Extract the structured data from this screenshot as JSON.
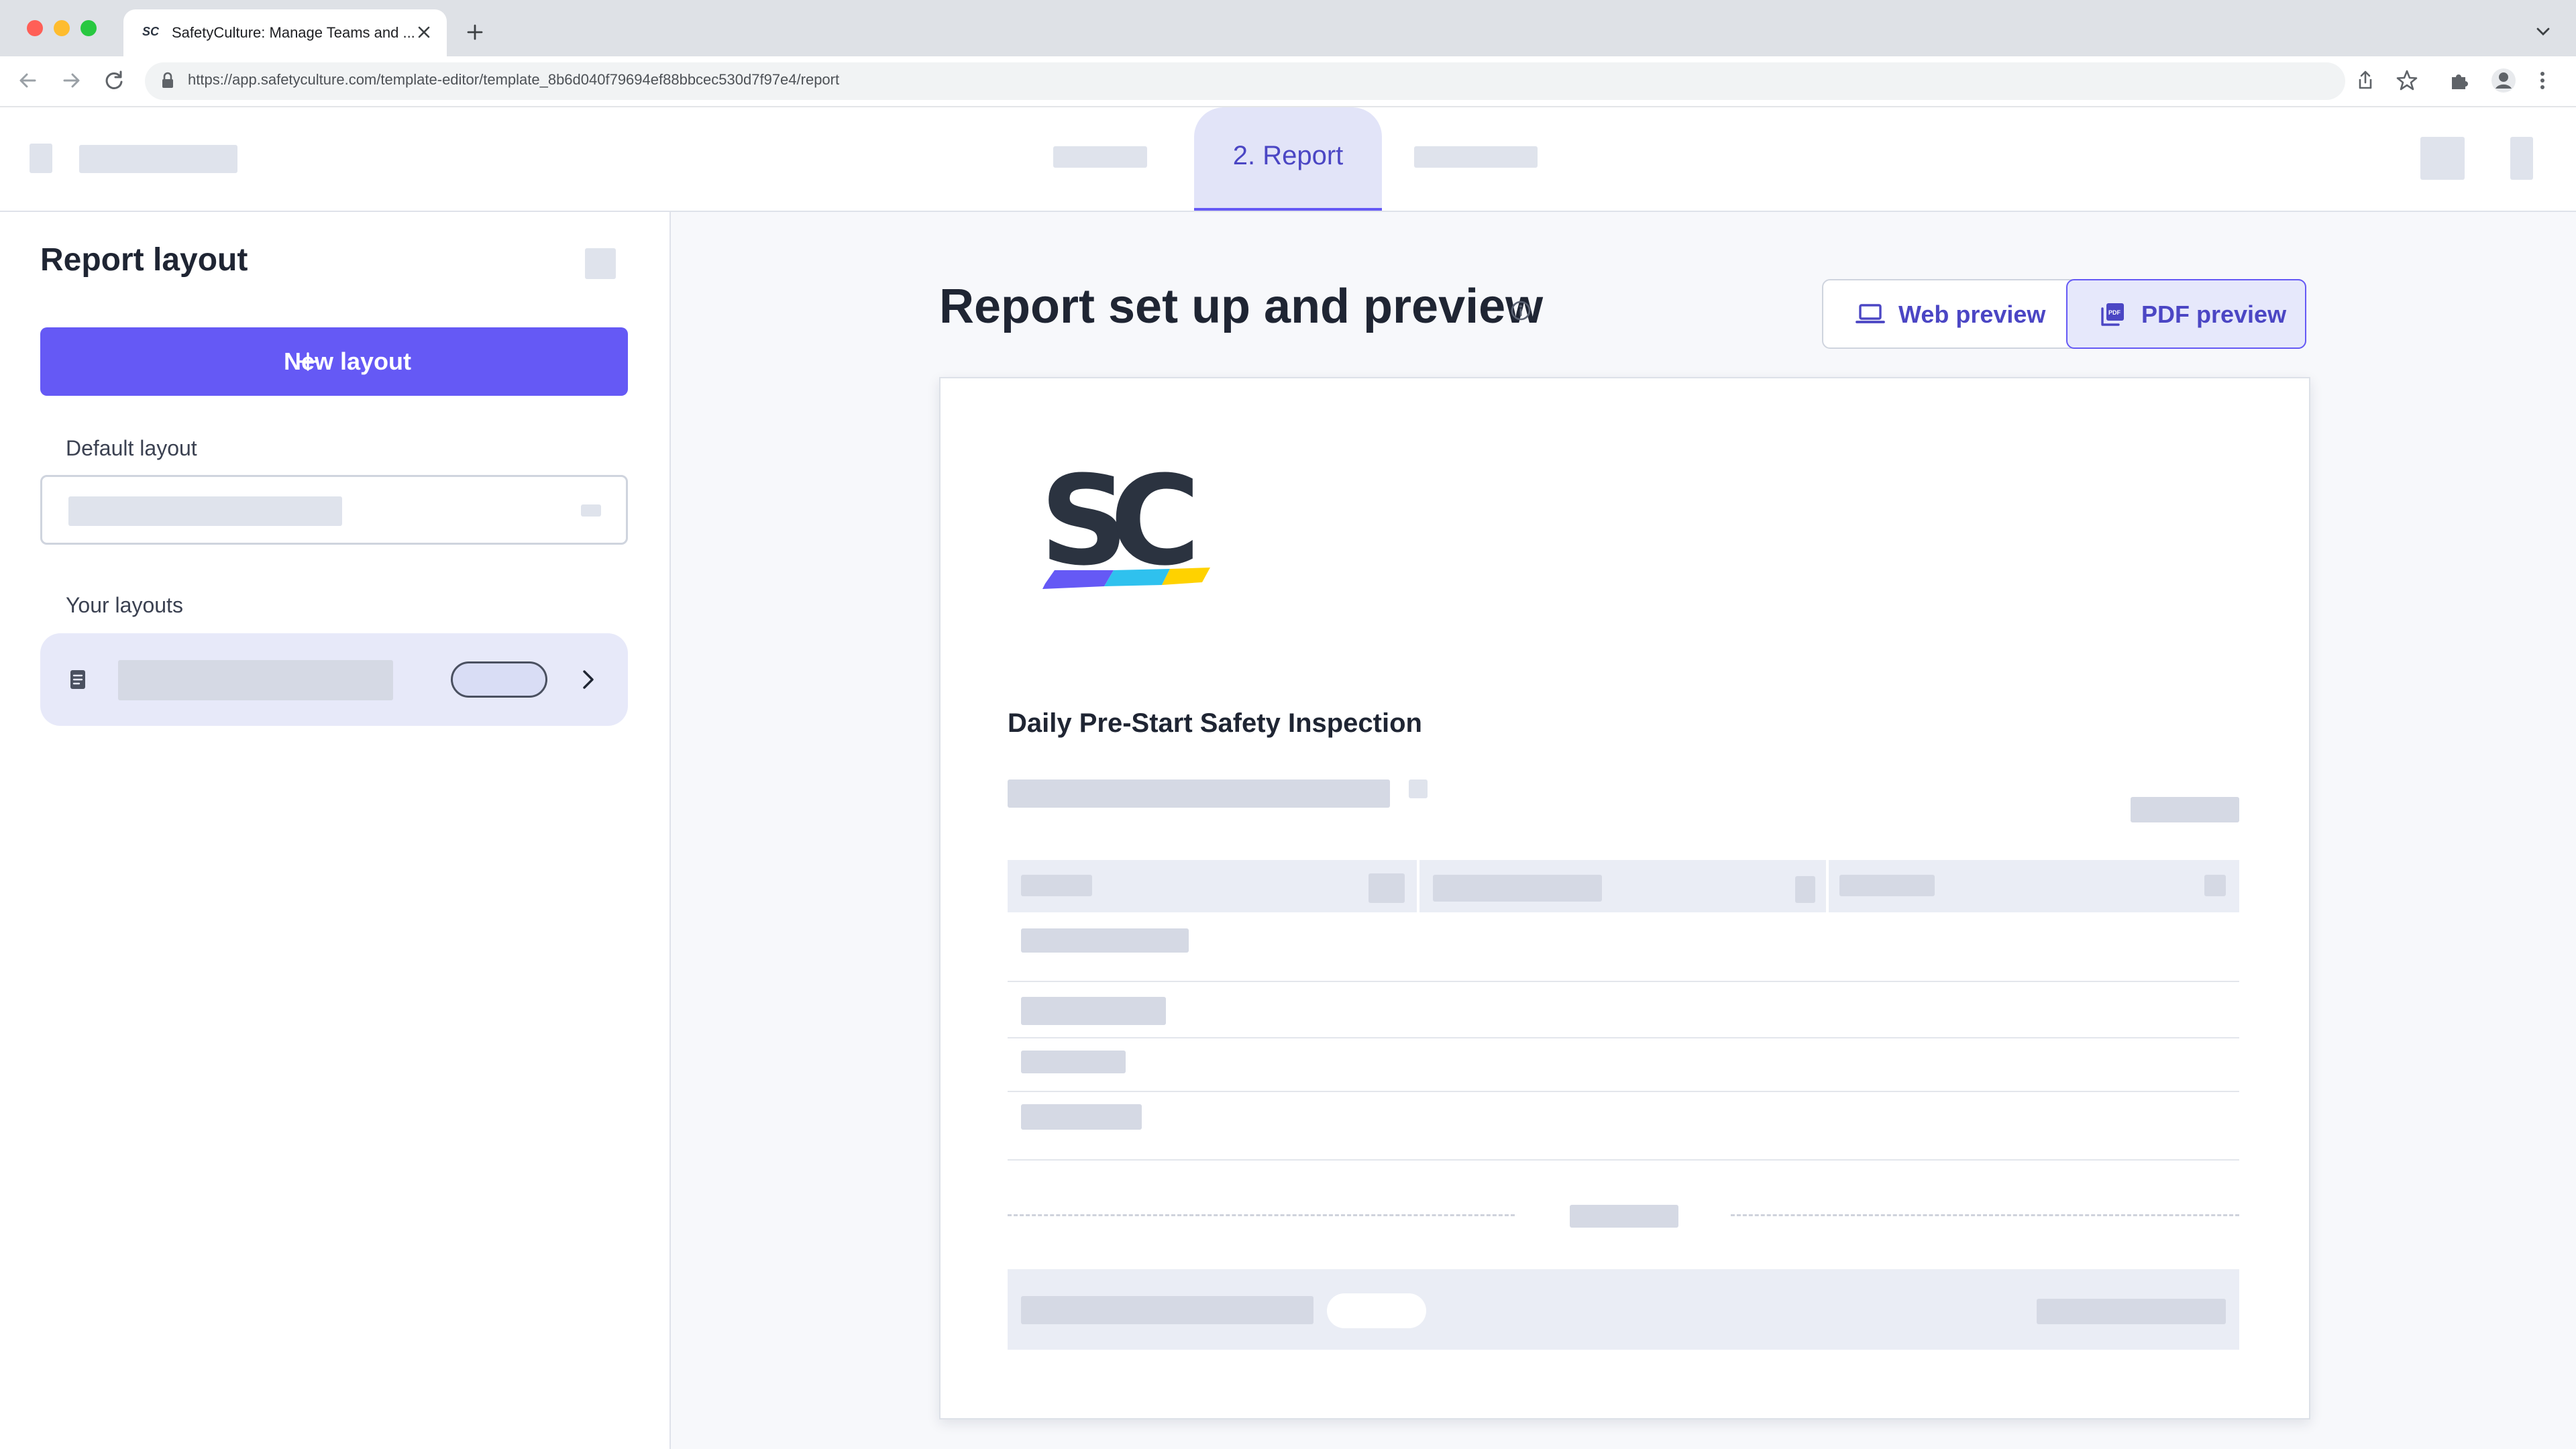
{
  "browser": {
    "tab_title": "SafetyCulture: Manage Teams and ...",
    "url": "https://app.safetyculture.com/template-editor/template_8b6d040f79694ef88bbcec530d7f97e4/report",
    "colors": {
      "close": "#ff5f57",
      "minimize": "#febc2e",
      "zoom": "#28c840"
    }
  },
  "header": {
    "active_tab_label": "2. Report"
  },
  "left_panel": {
    "title": "Report layout",
    "new_layout_label": "New layout",
    "default_layout_label": "Default layout",
    "your_layouts_label": "Your layouts"
  },
  "main": {
    "title": "Report set up and preview",
    "web_preview_label": "Web preview",
    "pdf_preview_label": "PDF preview",
    "report_title": "Daily Pre-Start Safety Inspection"
  },
  "colors": {
    "accent": "#6559f5",
    "accent_text": "#4b46c4",
    "active_tab_bg": "#e2e4f8",
    "placeholder": "#d5d9e4"
  }
}
